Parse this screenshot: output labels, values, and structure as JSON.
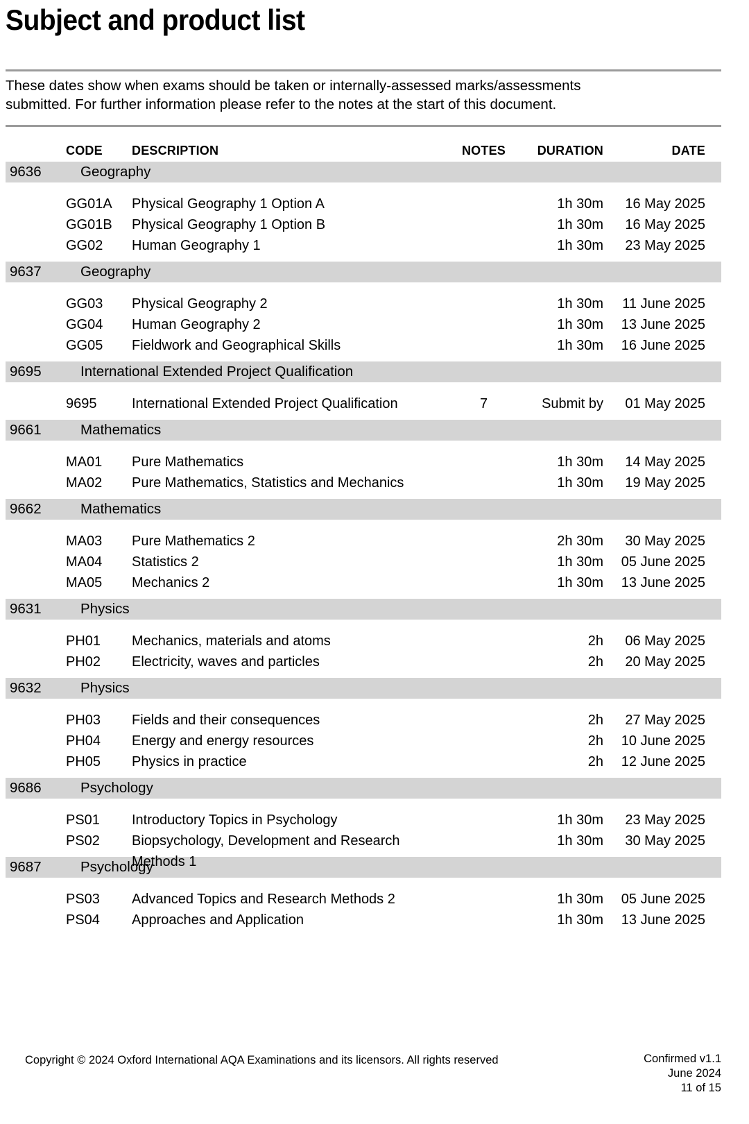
{
  "document": {
    "title": "Subject and product list",
    "intro": "These dates show when exams should be taken or internally-assessed marks/assessments\nsubmitted.  For further information please refer to the notes at the start of this document."
  },
  "table": {
    "headers": {
      "code": "CODE",
      "description": "DESCRIPTION",
      "notes": "NOTES",
      "duration": "DURATION",
      "date": "DATE"
    },
    "groups": [
      {
        "code": "9636",
        "subject": "Geography",
        "rows": [
          {
            "code": "GG01A",
            "description": "Physical Geography 1 Option A",
            "notes": "",
            "duration": "1h 30m",
            "date": "16 May 2025"
          },
          {
            "code": "GG01B",
            "description": "Physical Geography 1 Option B",
            "notes": "",
            "duration": "1h 30m",
            "date": "16 May 2025"
          },
          {
            "code": "GG02",
            "description": "Human Geography 1",
            "notes": "",
            "duration": "1h 30m",
            "date": "23 May 2025"
          }
        ]
      },
      {
        "code": "9637",
        "subject": "Geography",
        "rows": [
          {
            "code": "GG03",
            "description": "Physical Geography 2",
            "notes": "",
            "duration": "1h 30m",
            "date": "11 June 2025"
          },
          {
            "code": "GG04",
            "description": "Human Geography 2",
            "notes": "",
            "duration": "1h 30m",
            "date": "13 June 2025"
          },
          {
            "code": "GG05",
            "description": "Fieldwork and Geographical Skills",
            "notes": "",
            "duration": "1h 30m",
            "date": "16 June 2025"
          }
        ]
      },
      {
        "code": "9695",
        "subject": "International Extended Project Qualification",
        "rows": [
          {
            "code": "9695",
            "description": "International Extended Project Qualification",
            "notes": "7",
            "duration": "Submit by",
            "date": "01 May 2025"
          }
        ]
      },
      {
        "code": "9661",
        "subject": "Mathematics",
        "rows": [
          {
            "code": "MA01",
            "description": "Pure Mathematics",
            "notes": "",
            "duration": "1h 30m",
            "date": "14 May 2025"
          },
          {
            "code": "MA02",
            "description": "Pure Mathematics, Statistics and Mechanics",
            "notes": "",
            "duration": "1h 30m",
            "date": "19 May 2025"
          }
        ]
      },
      {
        "code": "9662",
        "subject": "Mathematics",
        "rows": [
          {
            "code": "MA03",
            "description": "Pure Mathematics 2",
            "notes": "",
            "duration": "2h 30m",
            "date": "30 May 2025"
          },
          {
            "code": "MA04",
            "description": "Statistics 2",
            "notes": "",
            "duration": "1h 30m",
            "date": "05 June 2025"
          },
          {
            "code": "MA05",
            "description": "Mechanics 2",
            "notes": "",
            "duration": "1h 30m",
            "date": "13 June 2025"
          }
        ]
      },
      {
        "code": "9631",
        "subject": "Physics",
        "rows": [
          {
            "code": "PH01",
            "description": "Mechanics, materials and atoms",
            "notes": "",
            "duration": "2h",
            "date": "06 May 2025"
          },
          {
            "code": "PH02",
            "description": "Electricity, waves and particles",
            "notes": "",
            "duration": "2h",
            "date": "20 May 2025"
          }
        ]
      },
      {
        "code": "9632",
        "subject": "Physics",
        "rows": [
          {
            "code": "PH03",
            "description": "Fields and their consequences",
            "notes": "",
            "duration": "2h",
            "date": "27 May 2025"
          },
          {
            "code": "PH04",
            "description": "Energy and energy resources",
            "notes": "",
            "duration": "2h",
            "date": "10 June 2025"
          },
          {
            "code": "PH05",
            "description": "Physics in practice",
            "notes": "",
            "duration": "2h",
            "date": "12 June 2025"
          }
        ]
      },
      {
        "code": "9686",
        "subject": "Psychology",
        "rows": [
          {
            "code": "PS01",
            "description": "Introductory Topics in Psychology",
            "notes": "",
            "duration": "1h 30m",
            "date": "23 May 2025"
          },
          {
            "code": "PS02",
            "description": "Biopsychology, Development and Research Methods 1",
            "notes": "",
            "duration": "1h 30m",
            "date": "30 May 2025"
          }
        ]
      },
      {
        "code": "9687",
        "subject": "Psychology",
        "rows": [
          {
            "code": "PS03",
            "description": "Advanced Topics and Research Methods 2",
            "notes": "",
            "duration": "1h 30m",
            "date": "05 June 2025"
          },
          {
            "code": "PS04",
            "description": "Approaches and Application",
            "notes": "",
            "duration": "1h 30m",
            "date": "13 June 2025"
          }
        ]
      }
    ]
  },
  "footer": {
    "copyright": "Copyright © 2024 Oxford International AQA Examinations and its licensors. All rights reserved",
    "version": "Confirmed v1.1",
    "date": "June 2024",
    "page": "11 of 15"
  },
  "colors": {
    "band": "#d4d4d4",
    "rule": "#9b9b9b",
    "text": "#000000",
    "background": "#ffffff"
  }
}
